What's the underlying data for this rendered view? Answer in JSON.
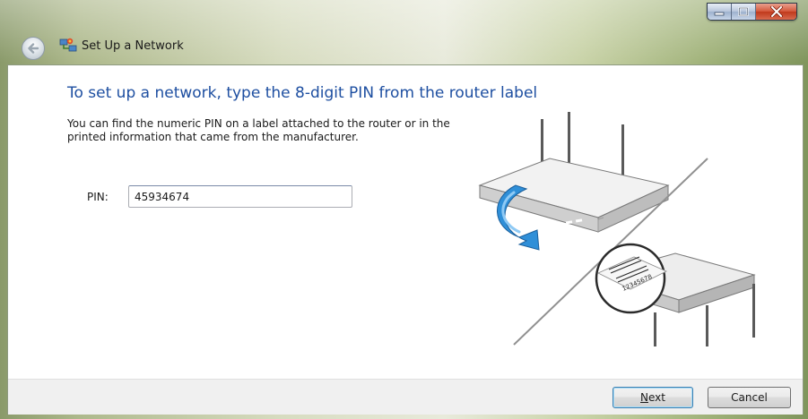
{
  "window": {
    "title": "Set Up a Network",
    "icons": {
      "back": "back-arrow-icon",
      "app": "network-setup-icon",
      "minimize": "minimize-icon",
      "maximize": "maximize-icon",
      "close": "close-icon"
    }
  },
  "content": {
    "heading": "To set up a network, type the 8-digit PIN from the router label",
    "description": "You can find the numeric PIN on a label attached to the router or in the printed information that came from the manufacturer.",
    "pin_label": "PIN:",
    "pin_value": "45934674",
    "illustration": {
      "label_number": "12345678"
    }
  },
  "footer": {
    "next_label_mnemonic": "N",
    "next_label_rest": "ext",
    "cancel_label": "Cancel"
  },
  "colors": {
    "heading": "#1e4fa1",
    "close_button": "#c0391c",
    "arrow": "#2f8fd8"
  }
}
